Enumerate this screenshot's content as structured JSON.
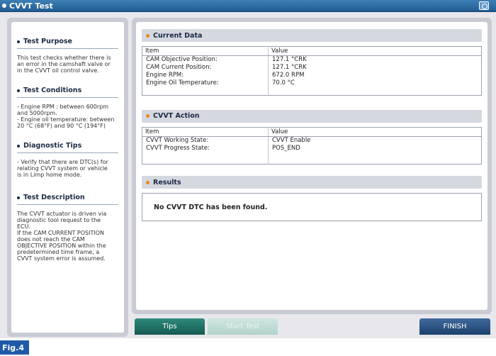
{
  "window": {
    "title": "CVVT Test"
  },
  "left": {
    "sections": [
      {
        "title": "Test Purpose",
        "text": "This test checks whether there is\nan error in the camshaft valve or\nin the CVVT oil control valve."
      },
      {
        "title": "Test Conditions",
        "text": "- Engine RPM : between 600rpm\nand 5000rpm.\n- Engine oil temperature: between\n20 °C (68°F) and 90 °C (194°F)"
      },
      {
        "title": "Diagnostic Tips",
        "text": "- Verify that there are DTC(s) for\nrelating CVVT system or vehicle\nis in Limp home mode."
      },
      {
        "title": "Test Description",
        "text": "The CVVT actuator is driven via\ndiagnostic tool request to the\nECU.\nIf the CAM CURRENT POSITION\ndoes not reach the CAM\nOBJECTIVE POSITION within the\npredetermined time frame, a\nCVVT system error is assumed."
      }
    ]
  },
  "current_data": {
    "title": "Current Data",
    "col_item": "Item",
    "col_value": "Value",
    "rows": [
      {
        "item": "CAM Objective Position:",
        "value": "127.1 °CRK"
      },
      {
        "item": "CAM Current Position:",
        "value": "127.1 °CRK"
      },
      {
        "item": "Engine RPM:",
        "value": "672.0 RPM"
      },
      {
        "item": "Engine Oil Temperature:",
        "value": "70.0 °C"
      }
    ]
  },
  "cvvt_action": {
    "title": "CVVT Action",
    "col_item": "Item",
    "col_value": "Value",
    "rows": [
      {
        "item": "CVVT Working State:",
        "value": "CVVT Enable"
      },
      {
        "item": "CVVT Progress State:",
        "value": "POS_END"
      }
    ]
  },
  "results": {
    "title": "Results",
    "message": "No CVVT DTC has been found."
  },
  "buttons": {
    "tips": "Tips",
    "start": "Start Test",
    "finish": "FINISH"
  },
  "figure_label": "Fig.4"
}
